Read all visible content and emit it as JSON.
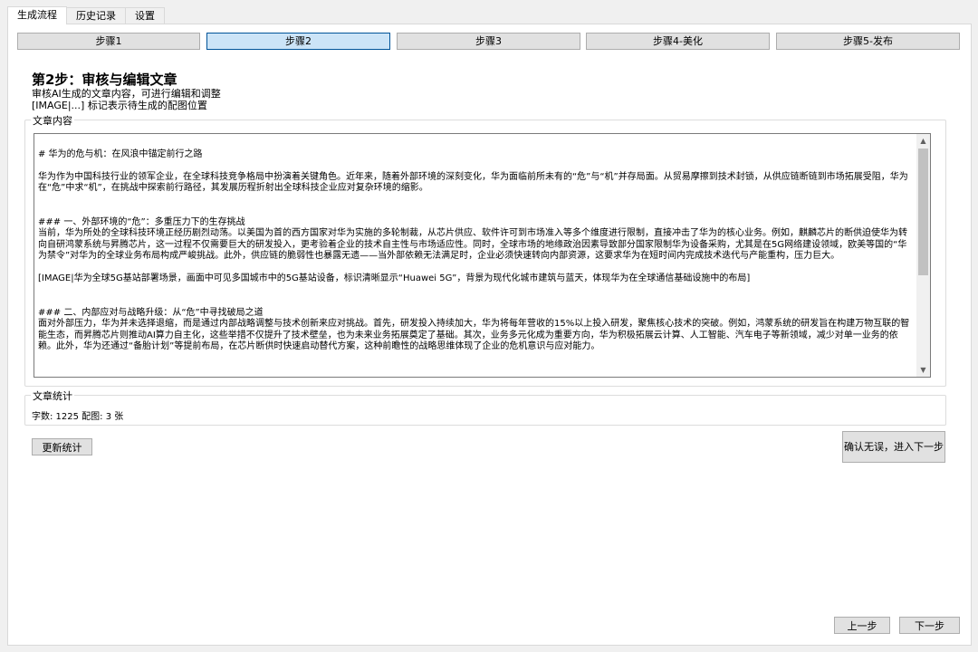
{
  "tabs": [
    "生成流程",
    "历史记录",
    "设置"
  ],
  "steps": [
    "步骤1",
    "步骤2",
    "步骤3",
    "步骤4-美化",
    "步骤5-发布"
  ],
  "active_step": 1,
  "page_title": "第2步：审核与编辑文章",
  "description": [
    "审核AI生成的文章内容，可进行编辑和调整",
    "[IMAGE|...] 标记表示待生成的配图位置"
  ],
  "content_group_label": "文章内容",
  "article": {
    "heading": "# 华为的危与机：在风浪中锚定前行之路",
    "intro": "华为作为中国科技行业的领军企业，在全球科技竞争格局中扮演着关键角色。近年来，随着外部环境的深刻变化，华为面临前所未有的“危”与“机”并存局面。从贸易摩擦到技术封锁，从供应链断链到市场拓展受阻，华为在“危”中求“机”，在挑战中探索前行路径，其发展历程折射出全球科技企业应对复杂环境的缩影。",
    "section1_title": "### 一、外部环境的“危”：多重压力下的生存挑战",
    "section1_body": "当前，华为所处的全球科技环境正经历剧烈动荡。以美国为首的西方国家对华为实施的多轮制裁，从芯片供应、软件许可到市场准入等多个维度进行限制，直接冲击了华为的核心业务。例如，麒麟芯片的断供迫使华为转向自研鸿蒙系统与昇腾芯片，这一过程不仅需要巨大的研发投入，更考验着企业的技术自主性与市场适应性。同时，全球市场的地缘政治因素导致部分国家限制华为设备采购，尤其是在5G网络建设领域，欧美等国的“华为禁令”对华为的全球业务布局构成严峻挑战。此外，供应链的脆弱性也暴露无遗——当外部依赖无法满足时，企业必须快速转向内部资源，这要求华为在短时间内完成技术迭代与产能重构，压力巨大。",
    "image_marker": "[IMAGE|华为全球5G基站部署场景，画面中可见多国城市中的5G基站设备，标识清晰显示“Huawei 5G”，背景为现代化城市建筑与蓝天，体现华为在全球通信基础设施中的布局]",
    "section2_title": "### 二、内部应对与战略升级：从“危”中寻找破局之道",
    "section2_body": "面对外部压力，华为并未选择退缩，而是通过内部战略调整与技术创新来应对挑战。首先，研发投入持续加大，华为将每年营收的15%以上投入研发，聚焦核心技术的突破。例如，鸿蒙系统的研发旨在构建万物互联的智能生态，而昇腾芯片则推动AI算力自主化，这些举措不仅提升了技术壁垒，也为未来业务拓展奠定了基础。其次，业务多元化成为重要方向，华为积极拓展云计算、人工智能、汽车电子等新领域，减少对单一业务的依赖。此外，华为还通过“备胎计划”等提前布局，在芯片断供时快速启动替代方案，这种前瞻性的战略思维体现了企业的危机意识与应对能力。"
  },
  "stats_group_label": "文章统计",
  "stats_text": "字数: 1225 配图: 3 张",
  "buttons": {
    "refresh": "更新统计",
    "confirm": "确认无误，进入下一步",
    "prev": "上一步",
    "next": "下一步"
  },
  "icons": {
    "scroll_up": "chevron-up-icon",
    "scroll_down": "chevron-down-icon"
  }
}
